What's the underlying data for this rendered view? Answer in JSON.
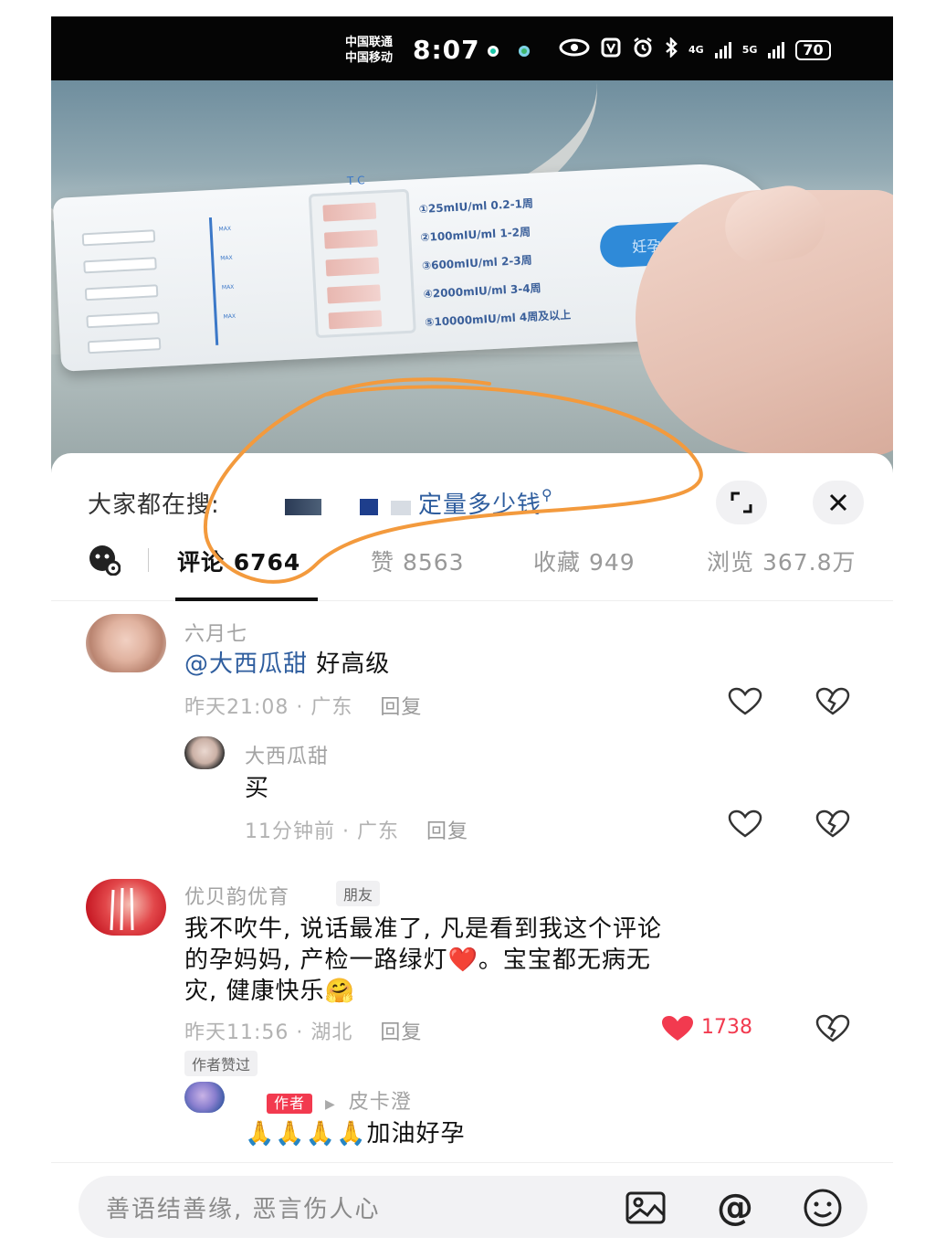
{
  "status_bar": {
    "carrier_1": "中国联通",
    "carrier_2": "中国移动",
    "time": "8:07",
    "network_1": "4G",
    "network_2": "5G",
    "battery": "70"
  },
  "photo": {
    "card_text": {
      "line_1": "①25mIU/ml  0.2-1周",
      "line_2": "②100mIU/ml  1-2周",
      "line_3": "③600mIU/ml  2-3周",
      "line_4": "④2000mIU/ml  3-4周",
      "line_5": "⑤10000mIU/ml  4周及以上",
      "brand": "妊孕周对比",
      "max_label": "MAX",
      "end_marker": "T C"
    }
  },
  "search": {
    "label": "大家都在搜:",
    "term": "定量多少钱"
  },
  "tabs": {
    "comments": "评论 6764",
    "likes": "赞 8563",
    "favorites": "收藏 949",
    "views": "浏览 367.8万"
  },
  "comments": [
    {
      "user": "六月七",
      "mention": "@大西瓜甜",
      "text": " 好高级",
      "time": "昨天21:08",
      "location": "广东",
      "reply_label": "回复",
      "reply": {
        "user": "大西瓜甜",
        "text": "买",
        "time": "11分钟前",
        "location": "广东",
        "reply_label": "回复"
      }
    },
    {
      "user": "优贝韵优育",
      "badge": "朋友",
      "text_line_1": "我不吹牛, 说话最准了, 凡是看到我这个评论",
      "text_line_2": "的孕妈妈, 产检一路绿灯❤️。宝宝都无病无",
      "text_line_3": "灾, 健康快乐🤗",
      "time": "昨天11:56",
      "location": "湖北",
      "reply_label": "回复",
      "likes": "1738",
      "author_liked": "作者赞过",
      "reply": {
        "author_tag": "作者",
        "user": "皮卡澄",
        "text": "🙏🙏🙏🙏加油好孕"
      }
    }
  ],
  "input": {
    "placeholder": "善语结善缘, 恶言伤人心"
  },
  "colors": {
    "accent_red": "#f23a4f",
    "mention_blue": "#2e5d9e",
    "annotation_orange": "#f39a3d"
  }
}
